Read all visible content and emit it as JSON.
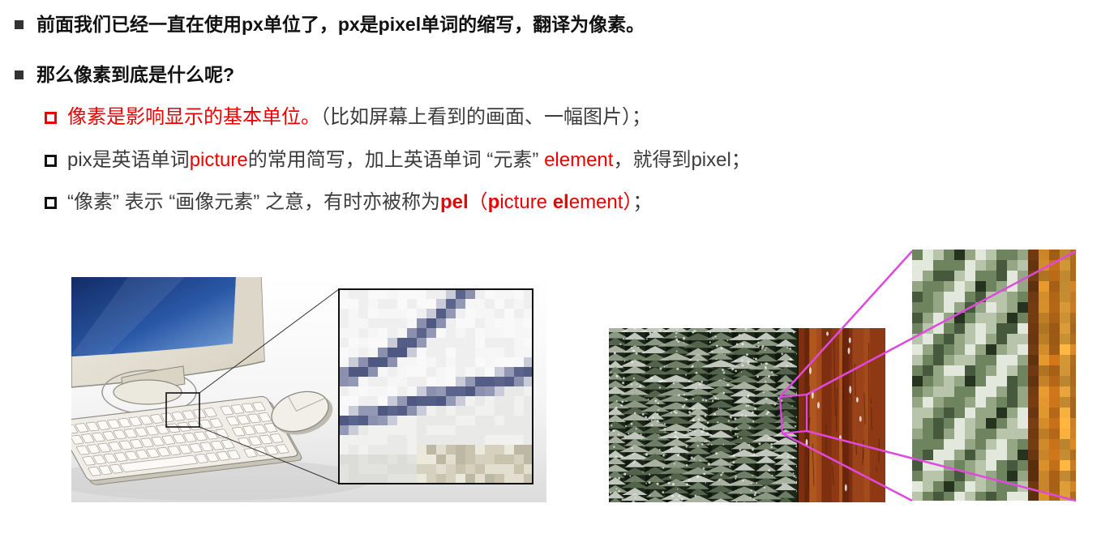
{
  "slide": {
    "bullets": [
      "前面我们已经一直在使用px单位了，px是pixel单词的缩写，翻译为像素。",
      "那么像素到底是什么呢?"
    ],
    "sub_bullets": [
      {
        "highlight": "像素是影响显示的基本单位。",
        "text": "（比如屏幕上看到的画面、一幅图片）；"
      },
      {
        "t1": "pix是英语单词",
        "h1": "picture",
        "t2": "的常用简写，加上英语单词 “元素” ",
        "h2": "element",
        "t3": "，就得到pixel；"
      },
      {
        "t1": "“像素” 表示 “画像元素” 之意，有时亦被称为",
        "h1": "pel",
        "h2": "（",
        "h3": "p",
        "h4": "icture ",
        "h5": "el",
        "h6": "ement）",
        "t2": "；"
      }
    ]
  },
  "colors": {
    "highlight_red": "#ee0000",
    "body_text": "#3c3c3c",
    "heading_text": "#111111",
    "zoom_outline_magenta": "#e048e0"
  }
}
